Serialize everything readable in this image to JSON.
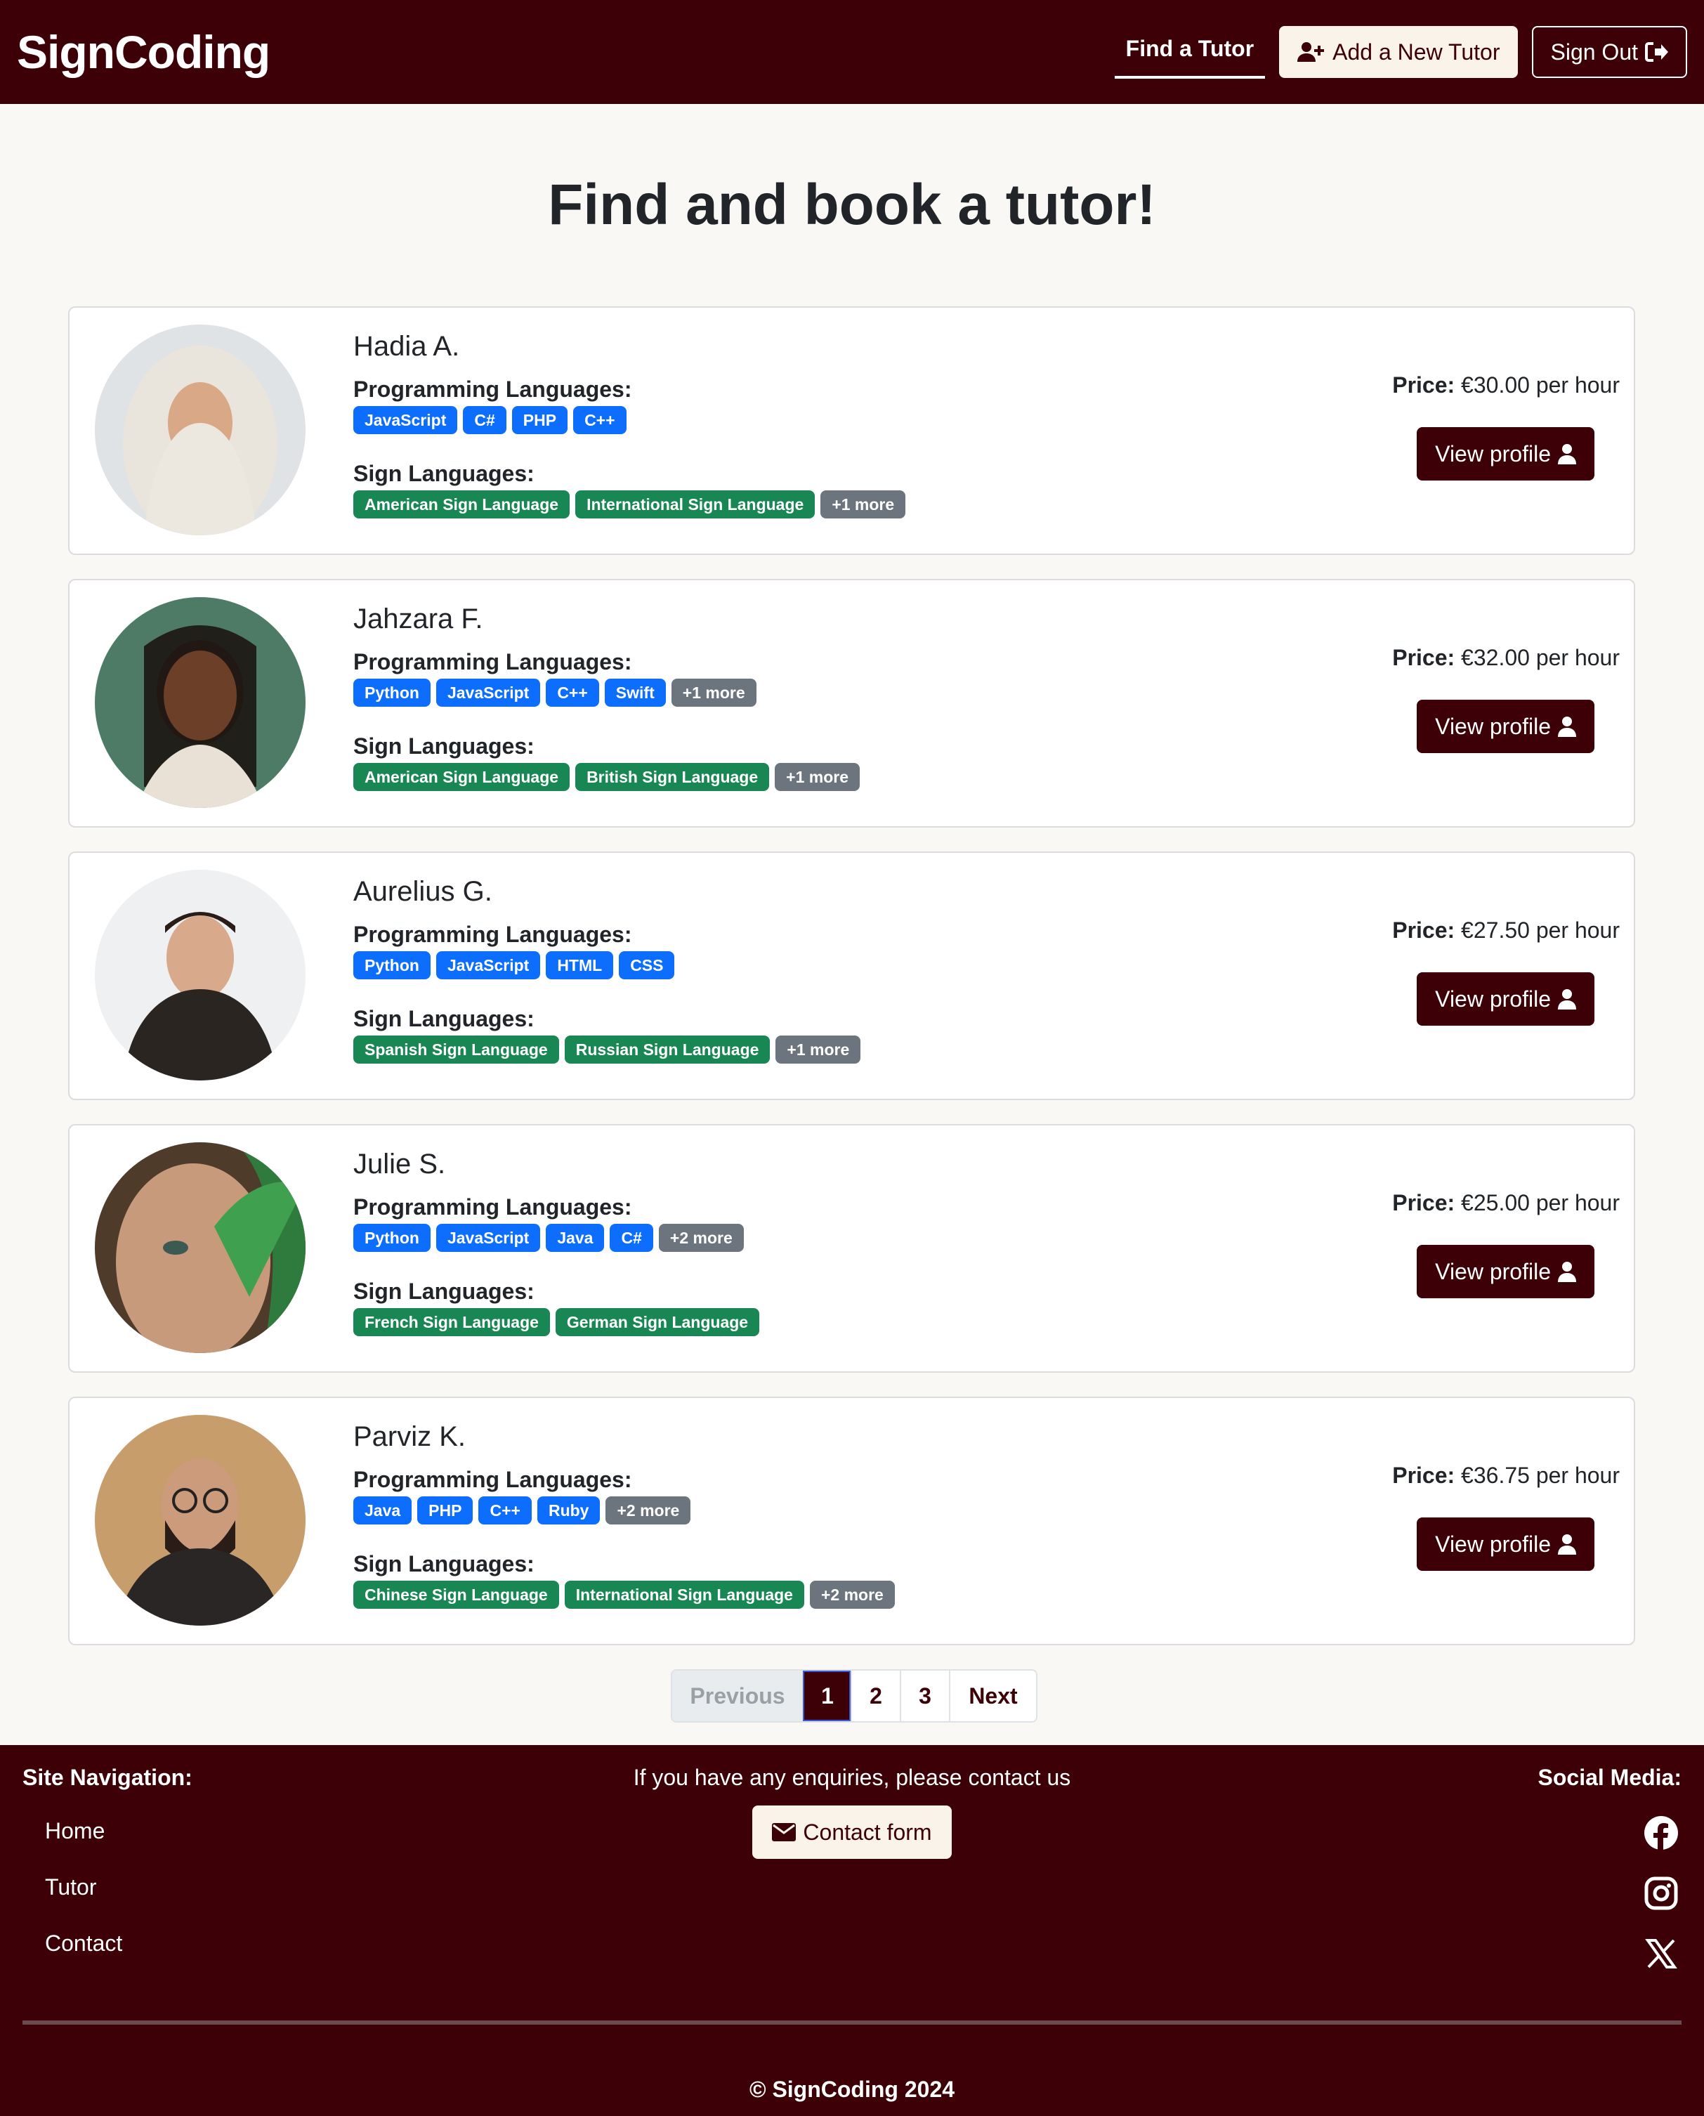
{
  "header": {
    "brand": "SignCoding",
    "nav_find": "Find a Tutor",
    "nav_add": "Add a New Tutor",
    "nav_signout": "Sign Out"
  },
  "main": {
    "title": "Find and book a tutor!",
    "labels": {
      "programming": "Programming Languages:",
      "sign": "Sign Languages:",
      "price": "Price:",
      "view": "View profile"
    },
    "tutors": [
      {
        "name": "Hadia A.",
        "programming": [
          "JavaScript",
          "C#",
          "PHP",
          "C++"
        ],
        "programming_more": "",
        "sign": [
          "American Sign Language",
          "International Sign Language"
        ],
        "sign_more": "+1 more",
        "price": "€30.00 per hour"
      },
      {
        "name": "Jahzara F.",
        "programming": [
          "Python",
          "JavaScript",
          "C++",
          "Swift"
        ],
        "programming_more": "+1 more",
        "sign": [
          "American Sign Language",
          "British Sign Language"
        ],
        "sign_more": "+1 more",
        "price": "€32.00 per hour"
      },
      {
        "name": "Aurelius G.",
        "programming": [
          "Python",
          "JavaScript",
          "HTML",
          "CSS"
        ],
        "programming_more": "",
        "sign": [
          "Spanish Sign Language",
          "Russian Sign Language"
        ],
        "sign_more": "+1 more",
        "price": "€27.50 per hour"
      },
      {
        "name": "Julie S.",
        "programming": [
          "Python",
          "JavaScript",
          "Java",
          "C#"
        ],
        "programming_more": "+2 more",
        "sign": [
          "French Sign Language",
          "German Sign Language"
        ],
        "sign_more": "",
        "price": "€25.00 per hour"
      },
      {
        "name": "Parviz K.",
        "programming": [
          "Java",
          "PHP",
          "C++",
          "Ruby"
        ],
        "programming_more": "+2 more",
        "sign": [
          "Chinese Sign Language",
          "International Sign Language"
        ],
        "sign_more": "+2 more",
        "price": "€36.75 per hour"
      }
    ]
  },
  "pagination": {
    "previous": "Previous",
    "pages": [
      "1",
      "2",
      "3"
    ],
    "current": "1",
    "next": "Next"
  },
  "footer": {
    "nav_title": "Site Navigation:",
    "links": [
      "Home",
      "Tutor",
      "Contact"
    ],
    "enquiry_text": "If you have any enquiries, please contact us",
    "contact_button": "Contact form",
    "social_title": "Social Media:",
    "social_icons": [
      "facebook-icon",
      "instagram-icon",
      "x-icon"
    ],
    "copyright": "© SignCoding 2024"
  },
  "colors": {
    "brand": "#3d0007",
    "programming_badge": "#0d6efd",
    "sign_badge": "#198754",
    "more_badge": "#6c757d"
  }
}
